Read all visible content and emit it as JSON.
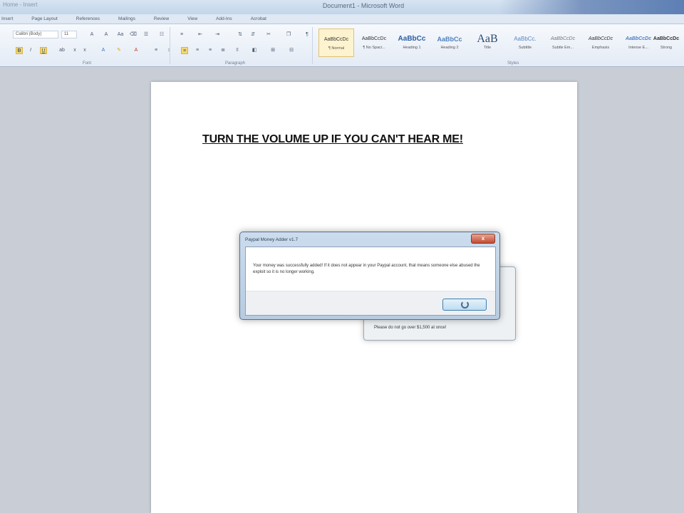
{
  "window": {
    "left_caption": "Home - Insert",
    "title": "Document1 - Microsoft Word"
  },
  "tabs": [
    "Insert",
    "Page Layout",
    "References",
    "Mailings",
    "Review",
    "View",
    "Add-Ins",
    "Acrobat"
  ],
  "ribbon": {
    "font_name": "Calibri (Body)",
    "font_size": "11",
    "group_labels": {
      "font": "Font",
      "paragraph": "Paragraph",
      "styles": "Styles"
    },
    "styles": [
      {
        "sample": "AaBbCcDc",
        "name": "¶ Normal"
      },
      {
        "sample": "AaBbCcDc",
        "name": "¶ No Spaci..."
      },
      {
        "sample": "AaBbCc",
        "name": "Heading 1"
      },
      {
        "sample": "AaBbCc",
        "name": "Heading 2"
      },
      {
        "sample": "AaB",
        "name": "Title"
      },
      {
        "sample": "AaBbCc.",
        "name": "Subtitle"
      },
      {
        "sample": "AaBbCcDc",
        "name": "Subtle Em..."
      },
      {
        "sample": "AaBbCcDc",
        "name": "Emphasis"
      },
      {
        "sample": "AaBbCcDc",
        "name": "Intense E..."
      },
      {
        "sample": "AaBbCcDc",
        "name": "Strong"
      }
    ]
  },
  "document": {
    "heading": "TURN THE VOLUME UP IF YOU CAN'T HEAR ME!"
  },
  "dialog_back": {
    "message": "Please do not go over $1,500 at once!"
  },
  "dialog": {
    "title": "Paypal Money Adder v1.7",
    "close_glyph": "x",
    "message": "Your money was successfully added! If it does not appear in your Paypal account, that means someone else abused the exploit so it is no longer working."
  }
}
